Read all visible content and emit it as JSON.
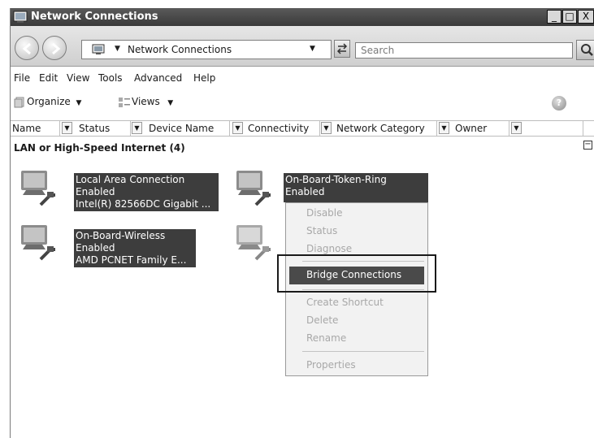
{
  "window": {
    "title": "Network Connections",
    "controls": [
      "_",
      "□",
      "X"
    ]
  },
  "address_bar": {
    "breadcrumb": "Network Connections",
    "search_placeholder": "Search"
  },
  "menu": [
    "File",
    "Edit",
    "View",
    "Tools",
    "Advanced",
    "Help"
  ],
  "toolbar": {
    "organize_label": "Organize",
    "views_label": "Views"
  },
  "columns": [
    "Name",
    "Status",
    "Device Name",
    "Connectivity",
    "Network Category",
    "Owner"
  ],
  "group": {
    "title": "LAN or High-Speed Internet (4)"
  },
  "connections": [
    {
      "name": "Local Area Connection",
      "status": "Enabled",
      "device": "Intel(R) 82566DC Gigabit ..."
    },
    {
      "name": "On-Board-Token-Ring",
      "status": "Enabled",
      "device": ""
    },
    {
      "name": "On-Board-Wireless",
      "status": "Enabled",
      "device": "AMD PCNET Family E..."
    }
  ],
  "context_menu": {
    "items": [
      "Disable",
      "Status",
      "Diagnose",
      "Bridge Connections",
      "Create Shortcut",
      "Delete",
      "Rename",
      "Properties"
    ],
    "highlighted": "Bridge Connections"
  },
  "icons": {
    "window": "network-folder-icon",
    "back": "back-arrow-icon",
    "forward": "forward-arrow-icon",
    "refresh": "refresh-icon",
    "search": "magnifier-icon",
    "organize": "organize-icon",
    "views": "views-icon",
    "help": "help-icon",
    "connection": "network-computer-icon"
  }
}
